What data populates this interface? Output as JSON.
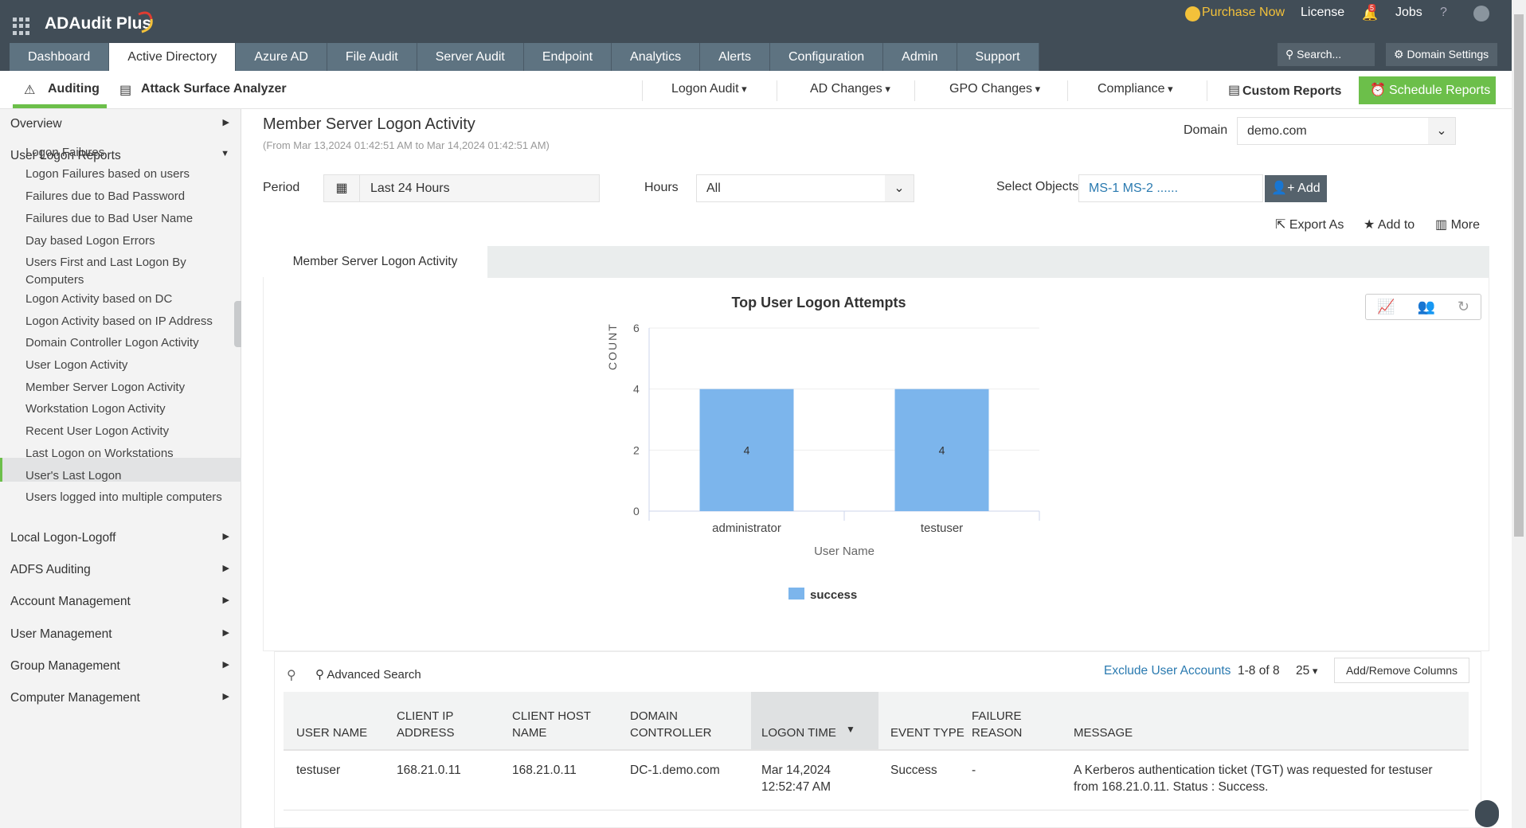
{
  "app": {
    "title": "ADAudit Plus"
  },
  "topbar": {
    "purchase": "Purchase Now",
    "license": "License",
    "notif_count": "5",
    "jobs": "Jobs",
    "help": "?",
    "search": "Search...",
    "domain_settings": "Domain Settings"
  },
  "tabs": [
    "Dashboard",
    "Active Directory",
    "Azure AD",
    "File Audit",
    "Server Audit",
    "Endpoint",
    "Analytics",
    "Alerts",
    "Configuration",
    "Admin",
    "Support"
  ],
  "subnav": {
    "auditing": "Auditing",
    "asa": "Attack Surface Analyzer",
    "logon_audit": "Logon Audit",
    "ad_changes": "AD Changes",
    "gpo_changes": "GPO Changes",
    "compliance": "Compliance",
    "custom_reports": "Custom Reports",
    "schedule_reports": "Schedule Reports"
  },
  "sidebar": {
    "overview": "Overview",
    "user_logon_reports": "User Logon Reports",
    "items": [
      "Logon Failures",
      "Logon Failures based on users",
      "Failures due to Bad Password",
      "Failures due to Bad User Name",
      "Day based Logon Errors",
      "Users First and Last Logon By Computers",
      "Logon Activity based on DC",
      "Logon Activity based on IP Address",
      "Domain Controller Logon Activity",
      "User Logon Activity",
      "Member Server Logon Activity",
      "Workstation Logon Activity",
      "Recent User Logon Activity",
      "Last Logon on Workstations",
      "User's Last Logon",
      "Users logged into multiple computers"
    ],
    "sections": [
      "Local Logon-Logoff",
      "ADFS Auditing",
      "Account Management",
      "User Management",
      "Group Management",
      "Computer Management"
    ]
  },
  "report": {
    "title": "Member Server Logon Activity",
    "range": "(From Mar 13,2024 01:42:51 AM to Mar 14,2024 01:42:51 AM)",
    "domain_label": "Domain",
    "domain": "demo.com",
    "period_label": "Period",
    "period": "Last 24 Hours",
    "hours_label": "Hours",
    "hours": "All",
    "objects_label": "Select Objects",
    "objects": "MS-1 MS-2 ......",
    "add": "Add",
    "export": "Export As",
    "add_to": "Add to",
    "more": "More",
    "tab": "Member Server Logon Activity"
  },
  "chart_data": {
    "type": "bar",
    "title": "Top User Logon Attempts",
    "categories": [
      "administrator",
      "testuser"
    ],
    "series": [
      {
        "name": "success",
        "values": [
          4,
          4
        ],
        "color": "#7cb5ec"
      }
    ],
    "xlabel": "User Name",
    "ylabel": "COUNT",
    "ylim": [
      0,
      6
    ],
    "yticks": [
      0,
      2,
      4,
      6
    ],
    "legend": "bottom",
    "grid": true
  },
  "table": {
    "adv_search": "Advanced Search",
    "exclude": "Exclude User Accounts",
    "count": "1-8 of 8",
    "page_size": "25",
    "add_remove": "Add/Remove Columns",
    "headers": [
      "USER NAME",
      "CLIENT IP ADDRESS",
      "CLIENT HOST NAME",
      "DOMAIN CONTROLLER",
      "LOGON TIME",
      "EVENT TYPE",
      "FAILURE REASON",
      "MESSAGE"
    ],
    "rows": [
      [
        "testuser",
        "168.21.0.11",
        "168.21.0.11",
        "DC-1.demo.com",
        "Mar 14,2024 12:52:47 AM",
        "Success",
        "-",
        "A Kerberos authentication ticket (TGT) was requested for testuser from 168.21.0.11. Status : Success."
      ]
    ]
  }
}
